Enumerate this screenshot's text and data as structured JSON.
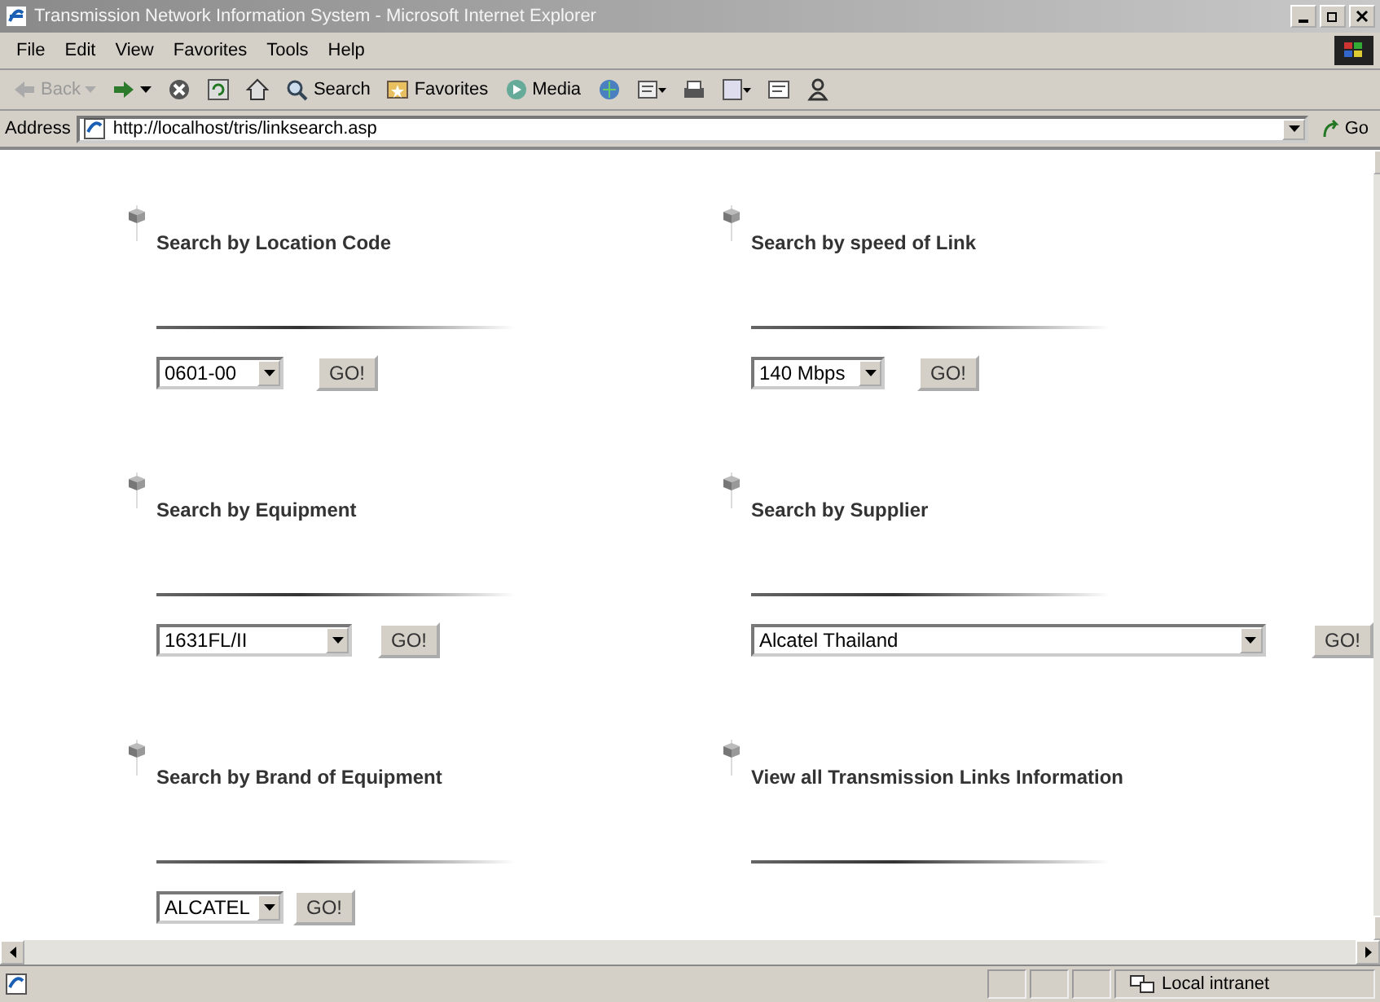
{
  "window": {
    "title": "Transmission Network Information System - Microsoft Internet Explorer"
  },
  "menu": [
    "File",
    "Edit",
    "View",
    "Favorites",
    "Tools",
    "Help"
  ],
  "toolbar": [
    {
      "kind": "back",
      "label": "Back",
      "disabled": true
    },
    {
      "kind": "forward",
      "disabled": false
    },
    {
      "kind": "stop"
    },
    {
      "kind": "refresh"
    },
    {
      "kind": "home"
    },
    {
      "kind": "search",
      "label": "Search"
    },
    {
      "kind": "favorites",
      "label": "Favorites"
    },
    {
      "kind": "media",
      "label": "Media"
    },
    {
      "kind": "history"
    },
    {
      "kind": "mail"
    },
    {
      "kind": "print"
    },
    {
      "kind": "edit"
    },
    {
      "kind": "discuss"
    },
    {
      "kind": "messenger"
    }
  ],
  "address": {
    "label": "Address",
    "value": "http://localhost/tris/linksearch.asp",
    "go": "Go"
  },
  "sections": [
    {
      "kind": "select",
      "heading": "Search by Location Code",
      "value": "0601-00",
      "button": "GO!"
    },
    {
      "kind": "select",
      "heading": "Search by speed of Link",
      "value": "140 Mbps",
      "button": "GO!"
    },
    {
      "kind": "select",
      "heading": "Search by Equipment",
      "value": "1631FL/II",
      "button": "GO!"
    },
    {
      "kind": "select",
      "heading": "Search by Supplier",
      "value": "Alcatel Thailand",
      "button": "GO!"
    },
    {
      "kind": "select",
      "heading": "Search by Brand of Equipment",
      "value": "ALCATEL",
      "button": "GO!"
    },
    {
      "kind": "link",
      "heading": "View all Transmission Links Information"
    }
  ],
  "status_bar": {
    "zone": "Local intranet"
  }
}
